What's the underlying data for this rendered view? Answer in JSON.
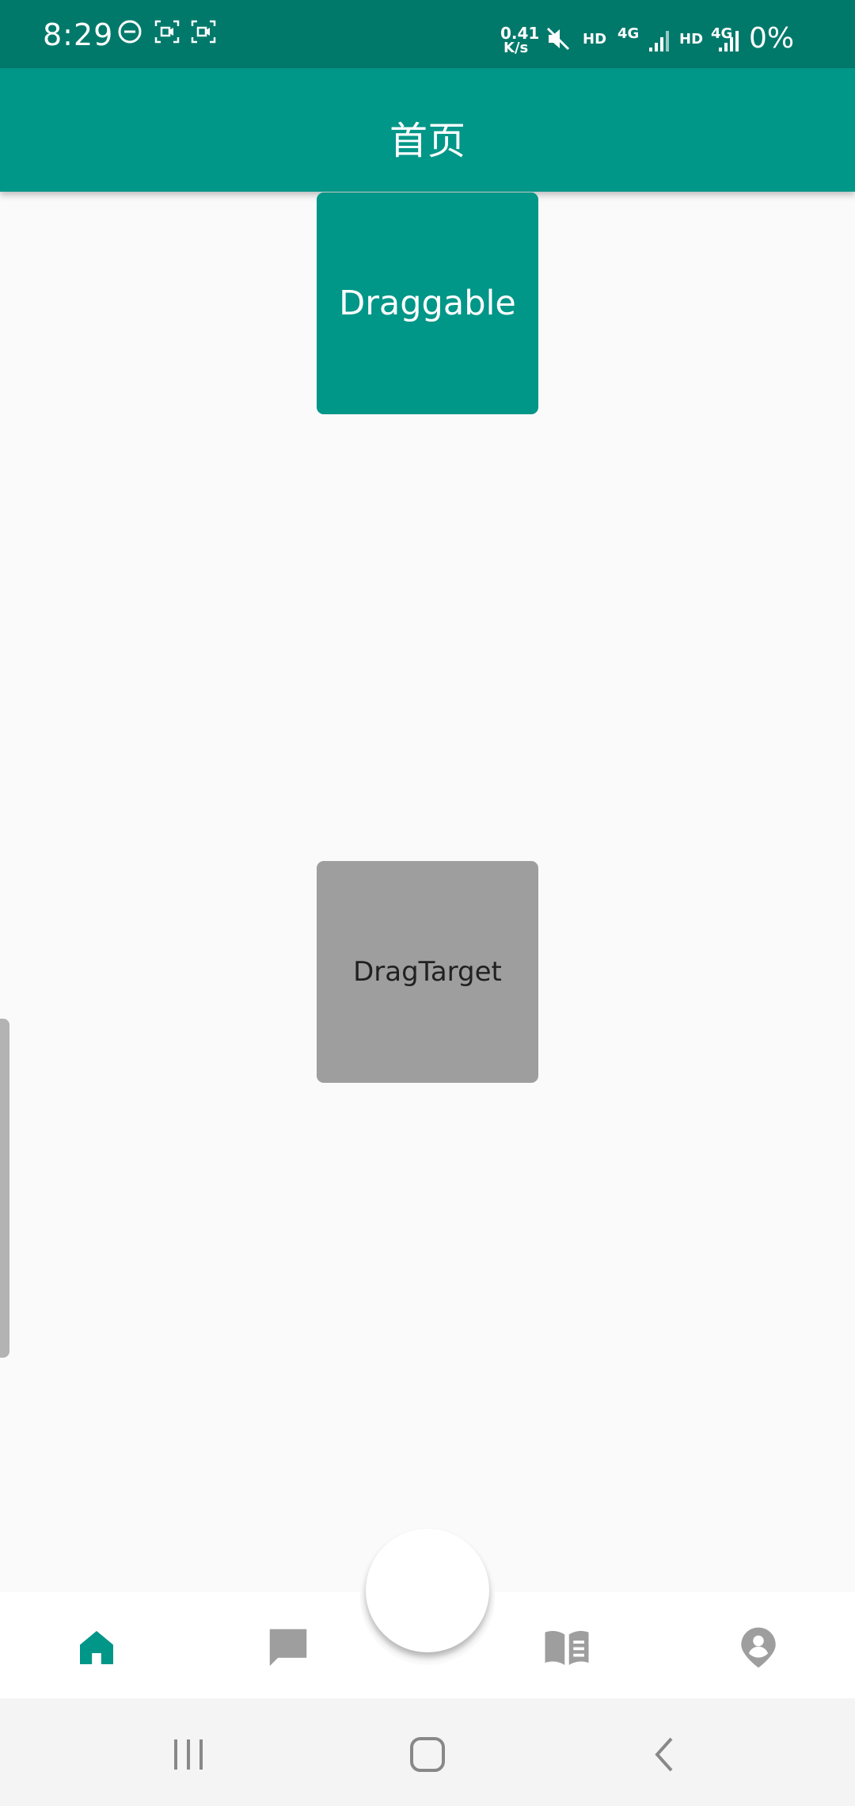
{
  "status_bar": {
    "time": "8:29",
    "net_speed_value": "0.41",
    "net_speed_unit": "K/s",
    "hd1": "HD",
    "net1": "4G",
    "hd2": "HD",
    "net2": "4G",
    "battery": "0%"
  },
  "app_bar": {
    "title": "首页"
  },
  "main": {
    "draggable_label": "Draggable",
    "drag_target_label": "DragTarget"
  },
  "bottom_nav": {
    "items": [
      {
        "icon": "home-icon",
        "active": true
      },
      {
        "icon": "chat-icon",
        "active": false
      },
      {
        "icon": "book-icon",
        "active": false
      },
      {
        "icon": "person-pin-icon",
        "active": false
      }
    ]
  },
  "colors": {
    "status_bar": "#00796b",
    "primary": "#009688",
    "target": "#9e9e9e",
    "nav_inactive": "#9e9e9e",
    "background": "#fafafa"
  }
}
